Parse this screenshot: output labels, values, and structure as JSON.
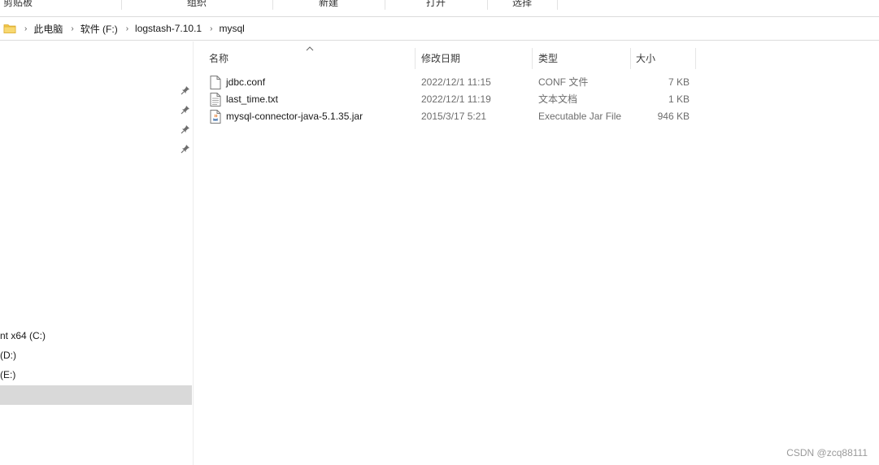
{
  "ribbon": {
    "groups": [
      "剪贴板",
      "组织",
      "新建",
      "打开",
      "选择"
    ]
  },
  "address": {
    "crumbs": [
      "此电脑",
      "软件 (F:)",
      "logstash-7.10.1",
      "mysql"
    ],
    "separator": "›"
  },
  "nav": {
    "drives": [
      "nt x64 (C:)",
      "(D:)",
      "(E:)"
    ]
  },
  "columns": {
    "name": "名称",
    "modified": "修改日期",
    "type": "类型",
    "size": "大小"
  },
  "files": [
    {
      "name": "jdbc.conf",
      "modified": "2022/12/1 11:15",
      "type": "CONF 文件",
      "size": "7 KB",
      "icon": "document-icon"
    },
    {
      "name": "last_time.txt",
      "modified": "2022/12/1 11:19",
      "type": "文本文档",
      "size": "1 KB",
      "icon": "text-file-icon"
    },
    {
      "name": "mysql-connector-java-5.1.35.jar",
      "modified": "2015/3/17 5:21",
      "type": "Executable Jar File",
      "size": "946 KB",
      "icon": "jar-file-icon"
    }
  ],
  "watermark": "CSDN @zcq88111",
  "colors": {
    "folder": "#f3c94b",
    "selection": "#d9d9d9",
    "jar_accent": "#e5792b"
  }
}
